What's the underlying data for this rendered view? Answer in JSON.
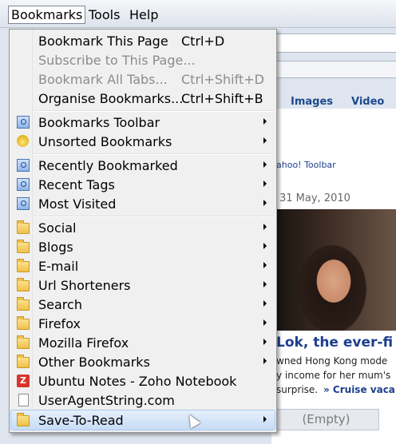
{
  "menubar": {
    "items": [
      {
        "label": "Bookmarks",
        "active": true
      },
      {
        "label": "Tools",
        "active": false
      },
      {
        "label": "Help",
        "active": false
      }
    ]
  },
  "background": {
    "tabs": [
      "Images",
      "Video"
    ],
    "toolbar_text": "ahoo! Toolbar",
    "date": "31 May, 2010",
    "headline": "Lok, the ever-fi",
    "line1": "wned Hong Kong mode",
    "line2": "y income for her mum's",
    "line3": "surprise.",
    "link": "» Cruise vaca",
    "empty_label": "(Empty)"
  },
  "menu": {
    "items": [
      {
        "label": "Bookmark This Page",
        "shortcut": "Ctrl+D",
        "disabled": false,
        "icon": "",
        "submenu": false
      },
      {
        "label": "Subscribe to This Page...",
        "shortcut": "",
        "disabled": true,
        "icon": "",
        "submenu": false
      },
      {
        "label": "Bookmark All Tabs...",
        "shortcut": "Ctrl+Shift+D",
        "disabled": true,
        "icon": "",
        "submenu": false
      },
      {
        "label": "Organise Bookmarks...",
        "shortcut": "Ctrl+Shift+B",
        "disabled": false,
        "icon": "",
        "submenu": false
      },
      {
        "label": "Bookmarks Toolbar",
        "shortcut": "",
        "disabled": false,
        "icon": "toolbar-icon",
        "submenu": true
      },
      {
        "label": "Unsorted Bookmarks",
        "shortcut": "",
        "disabled": false,
        "icon": "star-icon",
        "submenu": true
      },
      {
        "label": "Recently Bookmarked",
        "shortcut": "",
        "disabled": false,
        "icon": "smart-folder-icon",
        "submenu": true
      },
      {
        "label": "Recent Tags",
        "shortcut": "",
        "disabled": false,
        "icon": "smart-folder-icon",
        "submenu": true
      },
      {
        "label": "Most Visited",
        "shortcut": "",
        "disabled": false,
        "icon": "smart-folder-icon",
        "submenu": true
      },
      {
        "label": "Social",
        "shortcut": "",
        "disabled": false,
        "icon": "folder-icon",
        "submenu": true
      },
      {
        "label": "Blogs",
        "shortcut": "",
        "disabled": false,
        "icon": "folder-icon",
        "submenu": true
      },
      {
        "label": "E-mail",
        "shortcut": "",
        "disabled": false,
        "icon": "folder-icon",
        "submenu": true
      },
      {
        "label": "Url Shorteners",
        "shortcut": "",
        "disabled": false,
        "icon": "folder-icon",
        "submenu": true
      },
      {
        "label": "Search",
        "shortcut": "",
        "disabled": false,
        "icon": "folder-icon",
        "submenu": true
      },
      {
        "label": "Firefox",
        "shortcut": "",
        "disabled": false,
        "icon": "folder-icon",
        "submenu": true
      },
      {
        "label": "Mozilla Firefox",
        "shortcut": "",
        "disabled": false,
        "icon": "folder-icon",
        "submenu": true
      },
      {
        "label": "Other Bookmarks",
        "shortcut": "",
        "disabled": false,
        "icon": "folder-icon",
        "submenu": true
      },
      {
        "label": "Ubuntu Notes - Zoho Notebook",
        "shortcut": "",
        "disabled": false,
        "icon": "zoho-icon",
        "submenu": false
      },
      {
        "label": "UserAgentString.com",
        "shortcut": "",
        "disabled": false,
        "icon": "page-icon",
        "submenu": false
      },
      {
        "label": "Save-To-Read",
        "shortcut": "",
        "disabled": false,
        "icon": "folder-icon",
        "submenu": true,
        "highlighted": true
      }
    ]
  },
  "zoho_letter": "Z"
}
